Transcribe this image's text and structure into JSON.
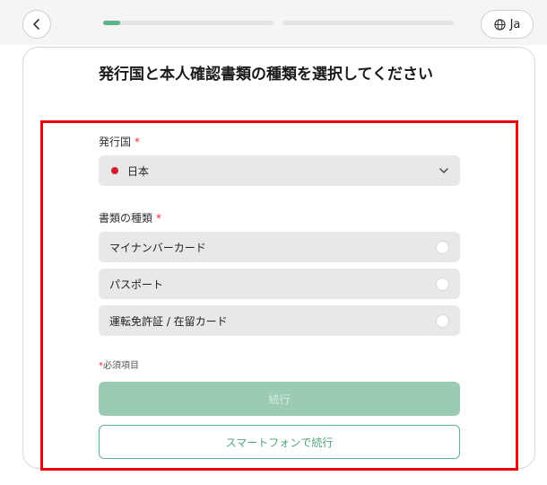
{
  "header": {
    "lang_label": "Ja",
    "progress": [
      0.1,
      0.0
    ]
  },
  "card": {
    "title": "発行国と本人確認書類の種類を選択してください",
    "country_label": "発行国",
    "required_mark": "*",
    "country_value": "日本",
    "doc_label": "書類の種類",
    "options": [
      {
        "label": "マイナンバーカード"
      },
      {
        "label": "パスポート"
      },
      {
        "label": "運転免許証 / 在留カード"
      }
    ],
    "required_note": "必須項目",
    "continue_label": "続行",
    "phone_label": "スマートフォンで続行"
  },
  "colors": {
    "accent": "#5fb38a",
    "accent_disabled": "#9ccbb4",
    "required": "#e03030",
    "highlight": "#e8000b",
    "flag": "#d21f2a"
  }
}
